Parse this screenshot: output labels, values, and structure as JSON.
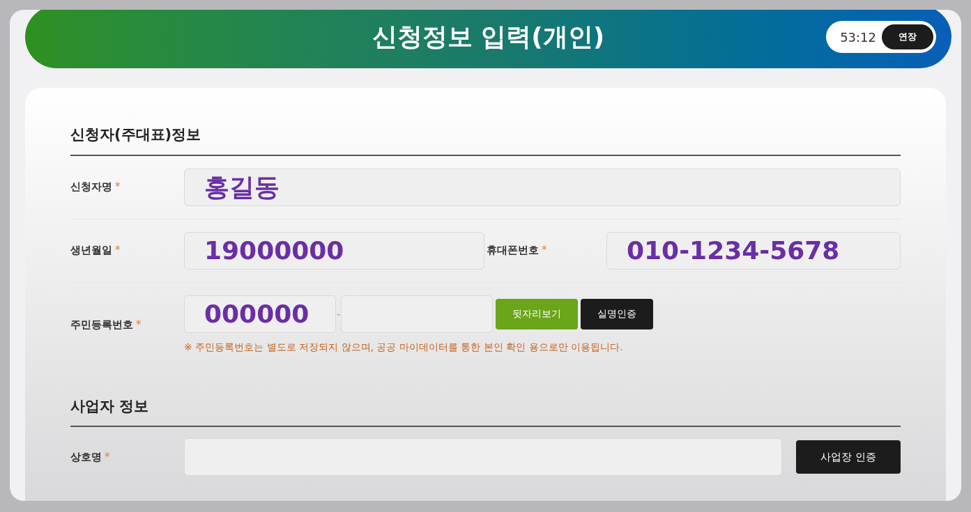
{
  "header": {
    "title": "신청정보 입력(개인)",
    "timer": "53:12",
    "extend_button": "연장"
  },
  "required_mark": "*",
  "sections": [
    {
      "title": "신청자(주대표)정보",
      "rows": [
        {
          "kind": "text",
          "label": "신청자명",
          "required": true,
          "value": "홍길동"
        },
        {
          "kind": "pair",
          "items": [
            {
              "label": "생년월일",
              "required": true,
              "value": "19000000"
            },
            {
              "label": "휴대폰번호",
              "required": true,
              "value": "010-1234-5678"
            }
          ]
        },
        {
          "kind": "rrn",
          "label": "주민등록번호",
          "required": true,
          "front": "000000",
          "separator": "-",
          "buttons": [
            {
              "label": "뒷자리보기",
              "kind": "green"
            },
            {
              "label": "실명인증",
              "kind": "dark"
            }
          ],
          "note": "※ 주민등록번호는 별도로 저장되지 않으며, 공공 마이데이터를 통한 본인 확인 용으로만 이용됩니다."
        }
      ]
    },
    {
      "title": "사업자 정보",
      "rows": [
        {
          "kind": "text_button",
          "label": "상호명",
          "required": true,
          "button": "사업장 인증"
        }
      ]
    }
  ]
}
